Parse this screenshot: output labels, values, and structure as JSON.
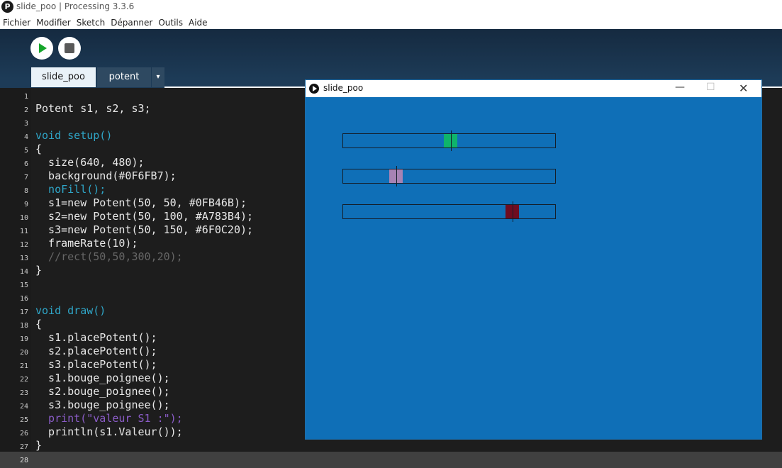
{
  "window": {
    "title": "slide_poo | Processing 3.3.6",
    "app_icon": "P"
  },
  "menu": [
    "Fichier",
    "Modifier",
    "Sketch",
    "Dépanner",
    "Outils",
    "Aide"
  ],
  "toolbar": {
    "run_icon": "play-icon",
    "stop_icon": "stop-icon"
  },
  "tabs": [
    {
      "label": "slide_poo",
      "active": true
    },
    {
      "label": "potent",
      "active": false
    }
  ],
  "tab_menu_glyph": "▾",
  "code": {
    "line_numbers": [
      "1",
      "2",
      "3",
      "4",
      "5",
      "6",
      "7",
      "8",
      "9",
      "10",
      "11",
      "12",
      "13",
      "14",
      "15",
      "16",
      "17",
      "18",
      "19",
      "20",
      "21",
      "22",
      "23",
      "24",
      "25",
      "26",
      "27",
      "28"
    ],
    "lines": [
      "",
      "Potent s1, s2, s3;",
      "",
      "void setup()",
      "{",
      "  size(640, 480);",
      "  background(#0F6FB7);",
      "  noFill();",
      "  s1=new Potent(50, 50, #0FB46B);",
      "  s2=new Potent(50, 100, #A783B4);",
      "  s3=new Potent(50, 150, #6F0C20);",
      "  frameRate(10);",
      "  //rect(50,50,300,20);",
      "}",
      "",
      "",
      "void draw()",
      "{",
      "  s1.placePotent();",
      "  s2.placePotent();",
      "  s3.placePotent();",
      "  s1.bouge_poignee();",
      "  s2.bouge_poignee();",
      "  s3.bouge_poignee();",
      "  print(\"valeur S1 :\");",
      "  println(s1.Valeur());",
      "}",
      ""
    ]
  },
  "sketch_window": {
    "title": "slide_poo",
    "background": "#0F6FB7",
    "minimize_glyph": "—",
    "maximize_glyph": "☐",
    "close_glyph": "✕",
    "sliders": [
      {
        "name": "s1",
        "color": "#0FB46B",
        "level": 0.51
      },
      {
        "name": "s2",
        "color": "#A783B4",
        "level": 0.25
      },
      {
        "name": "s3",
        "color": "#6F0C20",
        "level": 0.8
      }
    ]
  }
}
